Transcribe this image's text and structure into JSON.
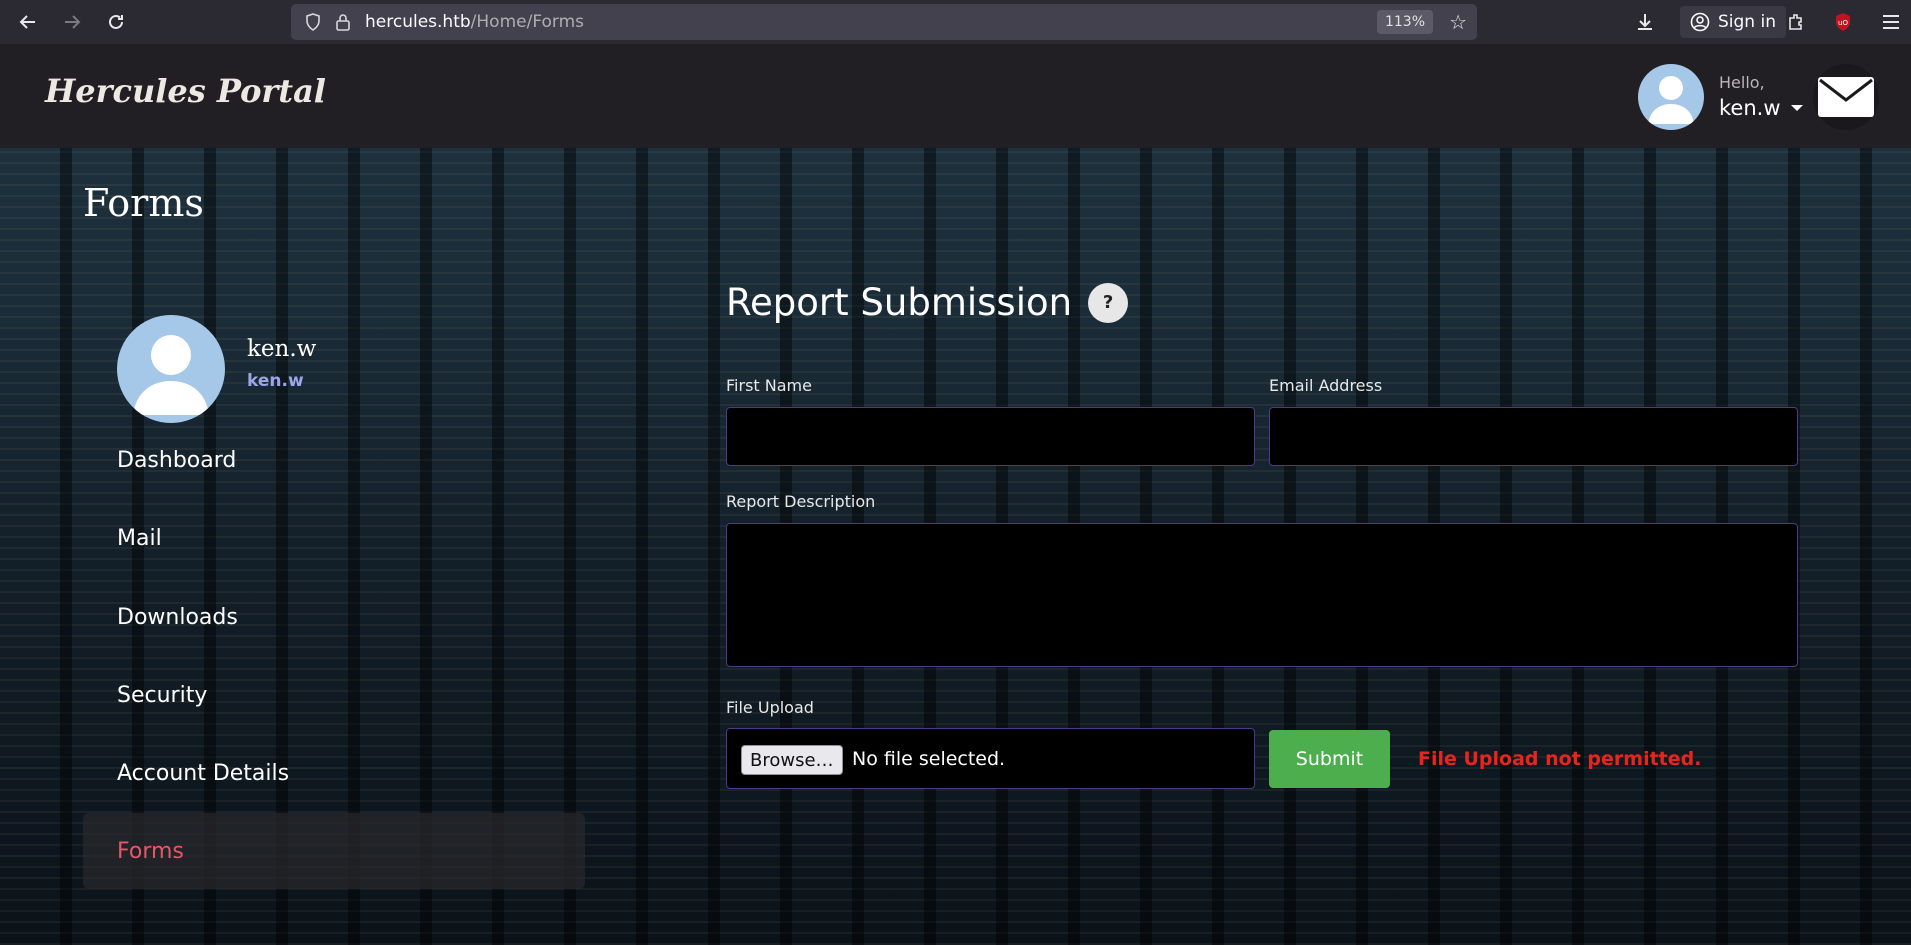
{
  "browser": {
    "url_host": "hercules.htb",
    "url_path": "/Home/Forms",
    "zoom": "113%",
    "signin_label": "Sign in"
  },
  "header": {
    "brand": "Hercules Portal",
    "hello": "Hello,",
    "username": "ken.w"
  },
  "page": {
    "title": "Forms"
  },
  "sidebar": {
    "user_name": "ken.w",
    "user_sub": "ken.w",
    "items": [
      {
        "label": "Dashboard"
      },
      {
        "label": "Mail"
      },
      {
        "label": "Downloads"
      },
      {
        "label": "Security"
      },
      {
        "label": "Account Details"
      },
      {
        "label": "Forms"
      }
    ],
    "active_color": "#e8566a"
  },
  "form": {
    "title": "Report Submission",
    "help_label": "?",
    "first_name_label": "First Name",
    "first_name_value": "",
    "email_label": "Email Address",
    "email_value": "",
    "description_label": "Report Description",
    "description_value": "",
    "file_label": "File Upload",
    "browse_label": "Browse…",
    "no_file_text": "No file selected.",
    "submit_label": "Submit",
    "error_text": "File Upload not permitted."
  },
  "colors": {
    "submit": "#4cae4c",
    "error": "#e8241f",
    "input_border": "#4d3a8a"
  }
}
